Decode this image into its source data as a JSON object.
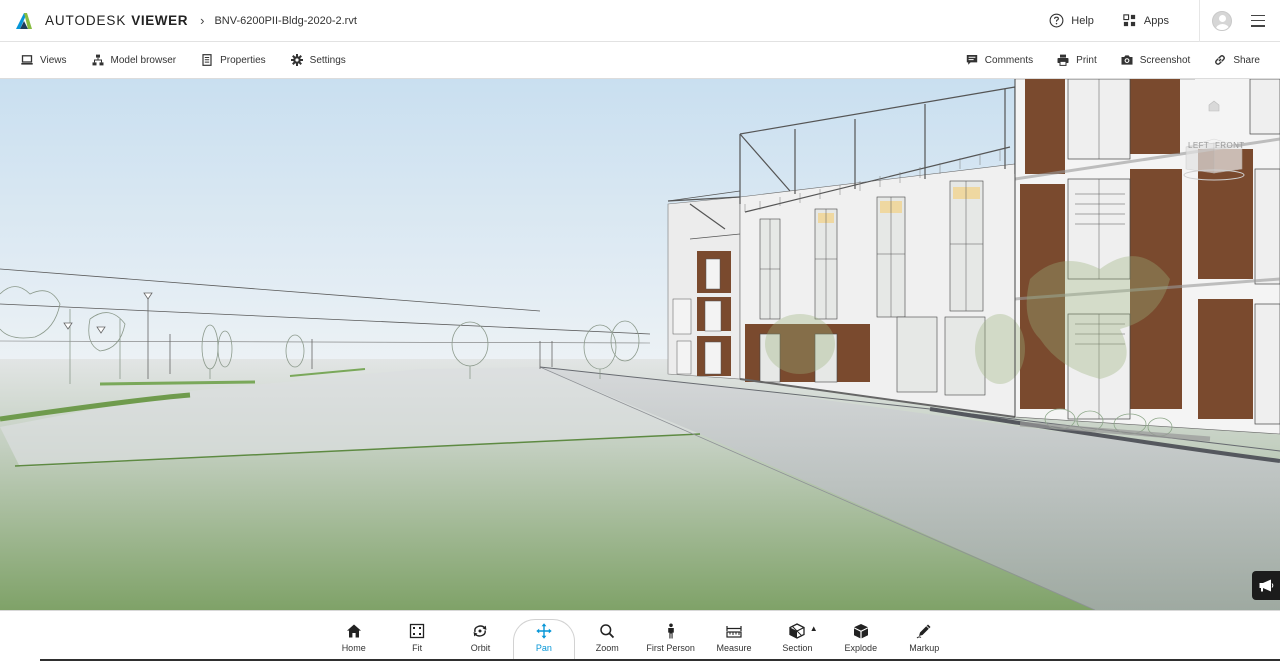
{
  "app": {
    "brand_first": "AUTODESK",
    "brand_second": "VIEWER",
    "file_name": "BNV-6200PII-Bldg-2020-2.rvt",
    "accent_color": "#0696d7"
  },
  "header": {
    "help_label": "Help",
    "apps_label": "Apps"
  },
  "toolbar": {
    "left": [
      {
        "id": "views",
        "label": "Views",
        "icon": "laptop-icon"
      },
      {
        "id": "model-browser",
        "label": "Model browser",
        "icon": "hierarchy-icon"
      },
      {
        "id": "properties",
        "label": "Properties",
        "icon": "document-icon"
      },
      {
        "id": "settings",
        "label": "Settings",
        "icon": "gear-icon"
      }
    ],
    "right": [
      {
        "id": "comments",
        "label": "Comments",
        "icon": "comment-icon"
      },
      {
        "id": "print",
        "label": "Print",
        "icon": "printer-icon"
      },
      {
        "id": "screenshot",
        "label": "Screenshot",
        "icon": "camera-icon"
      },
      {
        "id": "share",
        "label": "Share",
        "icon": "link-icon"
      }
    ]
  },
  "viewcube": {
    "left_face": "LEFT",
    "front_face": "FRONT"
  },
  "bottom_tools": [
    {
      "id": "home",
      "label": "Home",
      "icon": "home-icon",
      "active": false
    },
    {
      "id": "fit",
      "label": "Fit",
      "icon": "fit-icon",
      "active": false
    },
    {
      "id": "orbit",
      "label": "Orbit",
      "icon": "orbit-icon",
      "active": false
    },
    {
      "id": "pan",
      "label": "Pan",
      "icon": "pan-icon",
      "active": true
    },
    {
      "id": "zoom",
      "label": "Zoom",
      "icon": "zoom-icon",
      "active": false
    },
    {
      "id": "first-person",
      "label": "First Person",
      "icon": "person-icon",
      "active": false
    },
    {
      "id": "measure",
      "label": "Measure",
      "icon": "ruler-icon",
      "active": false
    },
    {
      "id": "section",
      "label": "Section",
      "icon": "section-box-icon",
      "active": false
    },
    {
      "id": "explode",
      "label": "Explode",
      "icon": "cube-icon",
      "active": false
    },
    {
      "id": "markup",
      "label": "Markup",
      "icon": "pencil-icon",
      "active": false
    }
  ]
}
